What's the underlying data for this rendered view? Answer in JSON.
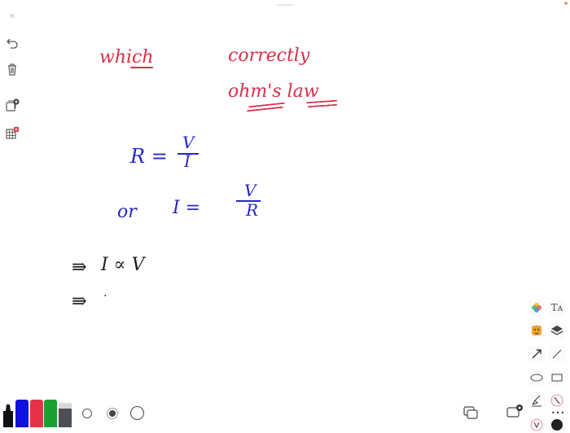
{
  "sidebar": {
    "collapse_icon": "double-chevron-left",
    "undo_icon": "undo-arrow",
    "trash_icon": "trash",
    "add_page_icon": "pages-plus",
    "grid_icon": "grid-with-badge"
  },
  "canvas": {
    "line1_left": "which",
    "line1_right": "correctly",
    "line2": "ohm's law",
    "eq1_lhs": "R =",
    "eq1_num": "V",
    "eq1_den": "I",
    "eq2_or": "or",
    "eq2_lhs": "I =",
    "eq2_num": "V",
    "eq2_den": "R",
    "impl1_arrow": "⇛",
    "impl1_text": "I ∝ V",
    "impl2_arrow": "⇛",
    "impl2_text": "·"
  },
  "pens": {
    "colors": [
      "#111111",
      "#1010e0",
      "#e8304a",
      "#18a030",
      "#4a4f55"
    ],
    "sizes": [
      "small",
      "medium",
      "large"
    ],
    "selected_size": "medium"
  },
  "right_tools": {
    "items": [
      "color-wheel",
      "text-style",
      "sticker",
      "layers",
      "arrow",
      "line",
      "ellipse",
      "rectangle",
      "highlighter",
      "laser-pointer",
      "voice",
      "fill"
    ],
    "text_label": "Tᴀ",
    "more_label": "•••"
  },
  "bottom_right": {
    "pages_icon": "pages",
    "screen_icon": "screen-record"
  }
}
